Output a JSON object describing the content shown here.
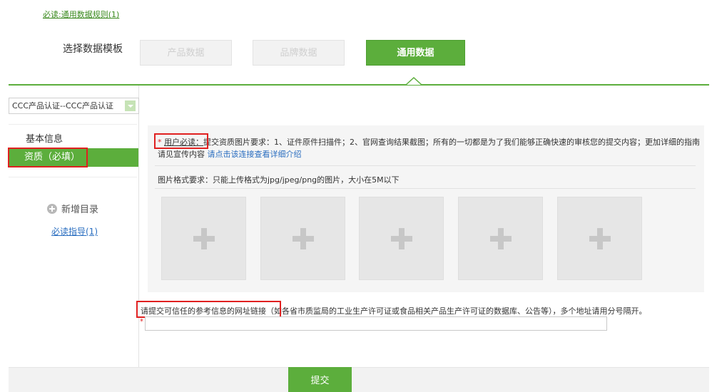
{
  "header": {
    "rule_link": "必读:通用数据规则(1)",
    "template_label": "选择数据模板",
    "templates": [
      {
        "label": "产品数据",
        "active": false
      },
      {
        "label": "品牌数据",
        "active": false
      },
      {
        "label": "通用数据",
        "active": true
      }
    ]
  },
  "sidebar": {
    "category_select": "CCC产品认证--CCC产品认证",
    "items": [
      {
        "label": "基本信息",
        "active": false
      },
      {
        "label": "资质（必填）",
        "active": true
      }
    ],
    "add_directory": "新增目录",
    "guide_link": "必读指导(1)"
  },
  "panel": {
    "required_star": "*",
    "required_label": "用户必读：",
    "requirement_text": "提交资质图片要求：1、证件原件扫描件；2、官网查询结果截图；所有的一切都是为了我们能够正确快速的审核您的提交内容；更加详细的指南请见宣传内容",
    "requirement_link": "请点击该连接查看详细介绍",
    "format_text": "图片格式要求：只能上传格式为jpg/jpeg/png的图片，大小在5M以下",
    "upload_slots": 5
  },
  "url_section": {
    "label_highlight": "请提交可信任的参考信息的网址链接",
    "label_rest": "（如各省市质监局的工业生产许可证或食品相关产品生产许可证的数据库、公告等），多个地址请用分号隔开。",
    "required_star": "*",
    "value": ""
  },
  "footer": {
    "submit_label": "提交"
  },
  "colors": {
    "accent_green": "#5cae3c",
    "highlight_red": "#e02020",
    "link_blue": "#2a6ec0"
  }
}
